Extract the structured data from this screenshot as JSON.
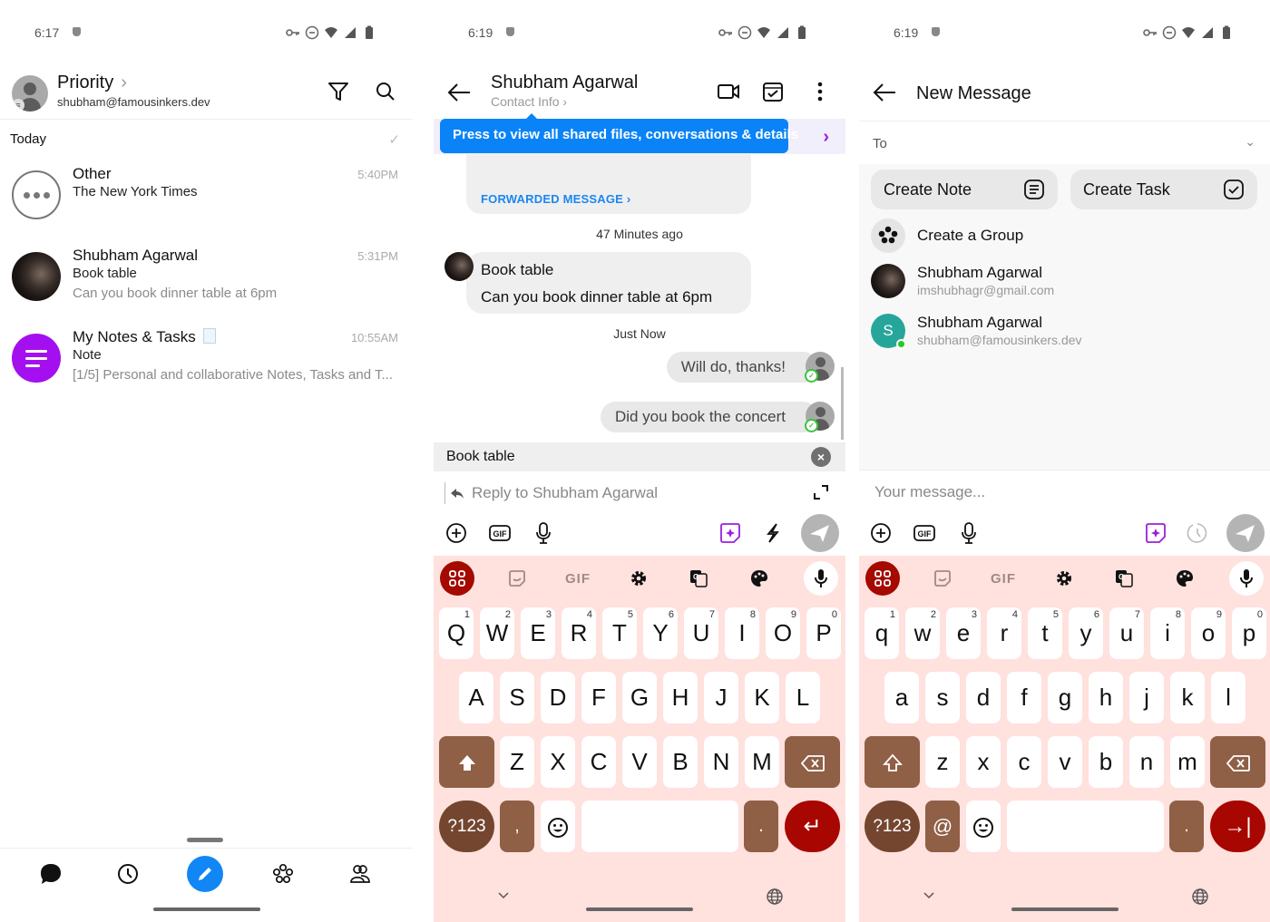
{
  "screens": [
    {
      "status": {
        "time": "6:17"
      },
      "header": {
        "title": "Priority",
        "account": "shubham@famousinkers.dev"
      },
      "section_label": "Today",
      "conversations": [
        {
          "name": "Other",
          "line2": "The New York Times",
          "line3": "",
          "time": "5:40PM",
          "avatar": "more-dots"
        },
        {
          "name": "Shubham Agarwal",
          "line2": "Book table",
          "line3": "Can you book dinner table at 6pm",
          "time": "5:31PM",
          "avatar": "photo"
        },
        {
          "name": "My Notes & Tasks",
          "line2": "Note",
          "line3": "[1/5] Personal and collaborative Notes, Tasks and T...",
          "time": "10:55AM",
          "avatar": "notes"
        }
      ],
      "bottom_nav": [
        "chats",
        "history",
        "compose",
        "groups",
        "contacts"
      ],
      "accent": "#1087f5"
    },
    {
      "status": {
        "time": "6:19"
      },
      "header": {
        "contact_name": "Shubham Agarwal",
        "contact_info": "Contact Info"
      },
      "tooltip": "Press to view all shared files, conversations & details",
      "forwarded_label": "FORWARDED MESSAGE",
      "separators": [
        "47 Minutes ago",
        "Just Now"
      ],
      "incoming": {
        "title": "Book table",
        "body": "Can you book dinner table at 6pm"
      },
      "outgoing": [
        "Will do, thanks!",
        "Did you book the concert"
      ],
      "reply_preview": "Book table",
      "compose_placeholder": "Reply to Shubham Agarwal",
      "keyboard": {
        "row1": [
          "Q",
          "W",
          "E",
          "R",
          "T",
          "Y",
          "U",
          "I",
          "O",
          "P"
        ],
        "row2": [
          "A",
          "S",
          "D",
          "F",
          "G",
          "H",
          "J",
          "K",
          "L"
        ],
        "row3": [
          "Z",
          "X",
          "C",
          "V",
          "B",
          "N",
          "M"
        ],
        "numbers": [
          "1",
          "2",
          "3",
          "4",
          "5",
          "6",
          "7",
          "8",
          "9",
          "0"
        ],
        "sym_label": "?123",
        "comma": ",",
        "period": ".",
        "enter": "↵",
        "top_gif": "GIF"
      }
    },
    {
      "status": {
        "time": "6:19"
      },
      "header": {
        "title": "New Message"
      },
      "to_label": "To",
      "actions": [
        "Create Note",
        "Create Task"
      ],
      "create_group": "Create a Group",
      "contacts": [
        {
          "name": "Shubham Agarwal",
          "email": "imshubhagr@gmail.com",
          "avatar": "photo"
        },
        {
          "name": "Shubham Agarwal",
          "email": "shubham@famousinkers.dev",
          "avatar": "S",
          "online": true
        }
      ],
      "compose_placeholder": "Your message...",
      "keyboard": {
        "row1": [
          "q",
          "w",
          "e",
          "r",
          "t",
          "y",
          "u",
          "i",
          "o",
          "p"
        ],
        "row2": [
          "a",
          "s",
          "d",
          "f",
          "g",
          "h",
          "j",
          "k",
          "l"
        ],
        "row3": [
          "z",
          "x",
          "c",
          "v",
          "b",
          "n",
          "m"
        ],
        "numbers": [
          "1",
          "2",
          "3",
          "4",
          "5",
          "6",
          "7",
          "8",
          "9",
          "0"
        ],
        "sym_label": "?123",
        "comma": "@",
        "period": ".",
        "enter": "→|",
        "top_gif": "GIF"
      }
    }
  ],
  "colors": {
    "keyboard_bg": "#ffe1dd",
    "key_special": "#8f5f46",
    "enter": "#a80600",
    "tooltip": "#0a83f7",
    "notes_avatar": "#a40ff0"
  }
}
